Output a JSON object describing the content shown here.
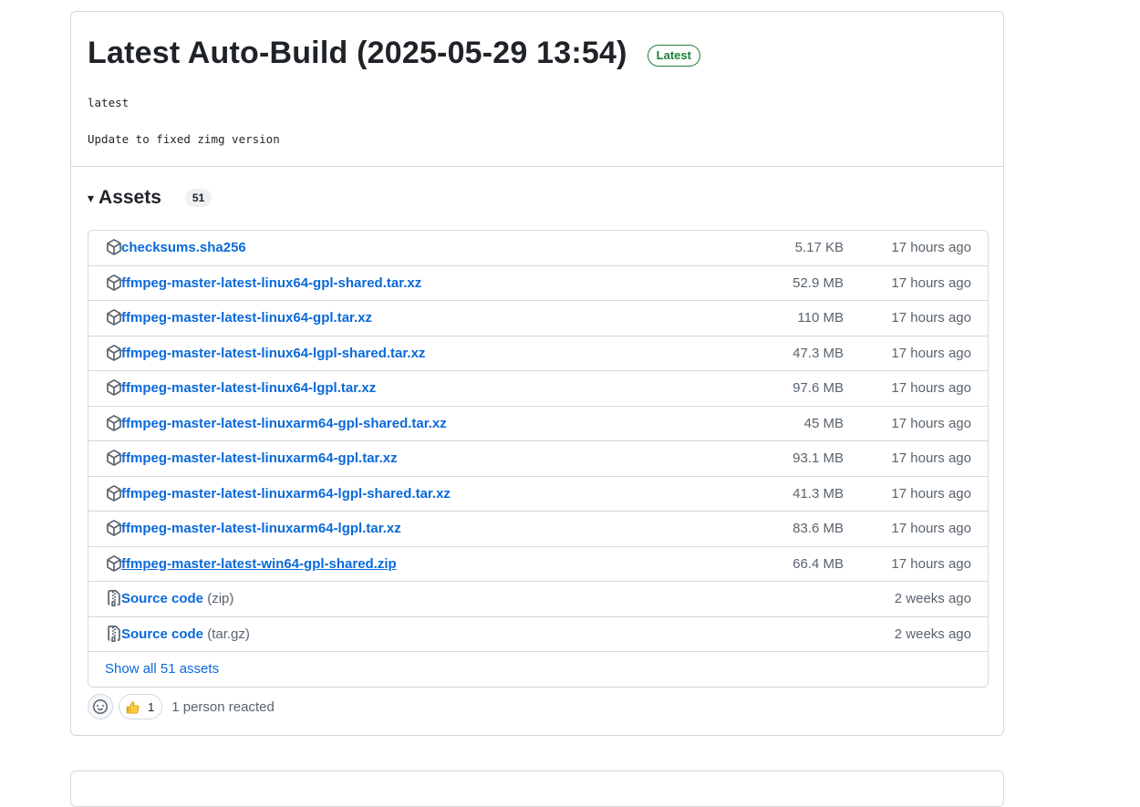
{
  "release": {
    "title": "Latest Auto-Build (2025-05-29 13:54)",
    "badge": "Latest",
    "tag": "latest",
    "notes": "Update to fixed zimg version"
  },
  "assets": {
    "caret": "▾",
    "heading": "Assets",
    "count": "51",
    "items": [
      {
        "name": "checksums.sha256",
        "size": "5.17 KB",
        "time": "17 hours ago",
        "icon": "package-icon"
      },
      {
        "name": "ffmpeg-master-latest-linux64-gpl-shared.tar.xz",
        "size": "52.9 MB",
        "time": "17 hours ago",
        "icon": "package-icon"
      },
      {
        "name": "ffmpeg-master-latest-linux64-gpl.tar.xz",
        "size": "110 MB",
        "time": "17 hours ago",
        "icon": "package-icon"
      },
      {
        "name": "ffmpeg-master-latest-linux64-lgpl-shared.tar.xz",
        "size": "47.3 MB",
        "time": "17 hours ago",
        "icon": "package-icon"
      },
      {
        "name": "ffmpeg-master-latest-linux64-lgpl.tar.xz",
        "size": "97.6 MB",
        "time": "17 hours ago",
        "icon": "package-icon"
      },
      {
        "name": "ffmpeg-master-latest-linuxarm64-gpl-shared.tar.xz",
        "size": "45 MB",
        "time": "17 hours ago",
        "icon": "package-icon"
      },
      {
        "name": "ffmpeg-master-latest-linuxarm64-gpl.tar.xz",
        "size": "93.1 MB",
        "time": "17 hours ago",
        "icon": "package-icon"
      },
      {
        "name": "ffmpeg-master-latest-linuxarm64-lgpl-shared.tar.xz",
        "size": "41.3 MB",
        "time": "17 hours ago",
        "icon": "package-icon"
      },
      {
        "name": "ffmpeg-master-latest-linuxarm64-lgpl.tar.xz",
        "size": "83.6 MB",
        "time": "17 hours ago",
        "icon": "package-icon"
      },
      {
        "name": "ffmpeg-master-latest-win64-gpl-shared.zip",
        "size": "66.4 MB",
        "time": "17 hours ago",
        "icon": "package-icon"
      }
    ],
    "source": [
      {
        "name": "Source code",
        "format": "(zip)",
        "time": "2 weeks ago",
        "icon": "file-zip-icon"
      },
      {
        "name": "Source code",
        "format": "(tar.gz)",
        "time": "2 weeks ago",
        "icon": "file-zip-icon"
      }
    ],
    "show_all": "Show all 51 assets"
  },
  "reactions": {
    "thumbs_up_count": "1",
    "summary": "1 person reacted"
  },
  "colors": {
    "link": "#0969da",
    "muted": "#59636e",
    "border": "#d1d9e0",
    "badge_green": "#1a7f37"
  }
}
